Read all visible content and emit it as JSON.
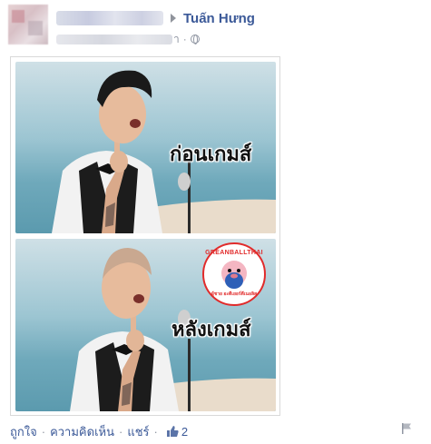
{
  "header": {
    "target_name": "Tuấn Hưng",
    "meta_suffix": "า",
    "meta_dot": "·"
  },
  "post": {
    "top_caption": "ก่อนเกมส์",
    "bottom_caption": "หลังเกมส์",
    "badge_top": "GREANBALLTHAI",
    "badge_bottom": "ผู้ชาย อะดีเยอร์ดีเนอลิส"
  },
  "actions": {
    "like_label": "ถูกใจ",
    "comment_label": "ความคิดเห็น",
    "share_label": "แชร์",
    "separator": "·",
    "like_count": "2"
  },
  "colors": {
    "link": "#3b5998",
    "muted": "#9197a3",
    "badge_red": "#e12b2b"
  },
  "icons": [
    "avatar",
    "arrow-right-icon",
    "globe-icon",
    "thumbs-up-icon",
    "flag-icon"
  ]
}
